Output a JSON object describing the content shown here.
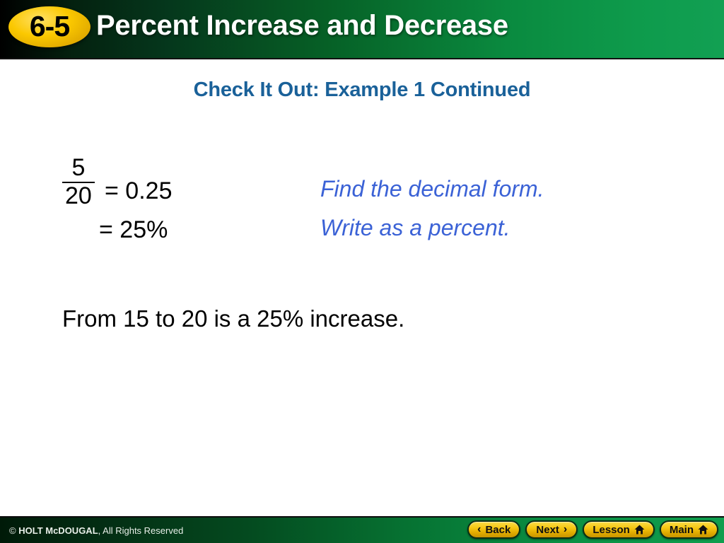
{
  "header": {
    "lesson_badge": "6-5",
    "title": "Percent Increase and Decrease",
    "badge_color": "#fbc800",
    "gradient_from": "#000000",
    "gradient_to": "#12a053",
    "title_color": "#ffffff"
  },
  "slide": {
    "subtitle": "Check It Out: Example 1 Continued",
    "subtitle_color": "#1a6199",
    "work": {
      "fraction": {
        "numerator": "5",
        "denominator": "20"
      },
      "line1_result": "= 0.25",
      "line1_note": "Find the decimal form.",
      "line2_result": "= 25%",
      "line2_note": "Write as a percent.",
      "note_color": "#3b62d6"
    },
    "conclusion": "From 15 to 20 is a 25% increase."
  },
  "footer": {
    "copyright_symbol": "©",
    "copyright_brand": "HOLT McDOUGAL",
    "copyright_rest": ", All Rights Reserved",
    "buttons": [
      {
        "label": "Back",
        "icon": "chevron-left-icon",
        "glyph": "‹"
      },
      {
        "label": "Next",
        "icon": "chevron-right-icon",
        "glyph": "›"
      },
      {
        "label": "Lesson",
        "icon": "home-icon",
        "glyph": ""
      },
      {
        "label": "Main",
        "icon": "home-icon",
        "glyph": ""
      }
    ],
    "button_color": "#f5c813",
    "gradient_from": "#001a08",
    "gradient_to": "#0f9e4e"
  }
}
